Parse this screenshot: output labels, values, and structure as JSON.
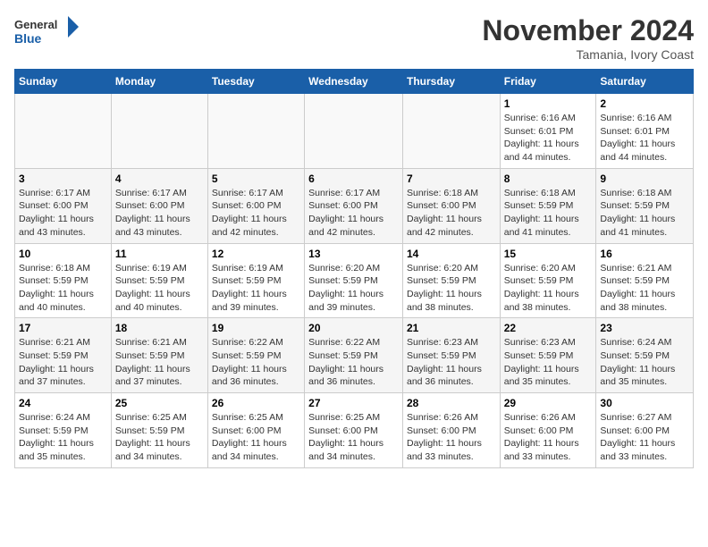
{
  "logo": {
    "general": "General",
    "blue": "Blue"
  },
  "header": {
    "month": "November 2024",
    "location": "Tamania, Ivory Coast"
  },
  "weekdays": [
    "Sunday",
    "Monday",
    "Tuesday",
    "Wednesday",
    "Thursday",
    "Friday",
    "Saturday"
  ],
  "weeks": [
    [
      {
        "day": "",
        "info": ""
      },
      {
        "day": "",
        "info": ""
      },
      {
        "day": "",
        "info": ""
      },
      {
        "day": "",
        "info": ""
      },
      {
        "day": "",
        "info": ""
      },
      {
        "day": "1",
        "info": "Sunrise: 6:16 AM\nSunset: 6:01 PM\nDaylight: 11 hours and 44 minutes."
      },
      {
        "day": "2",
        "info": "Sunrise: 6:16 AM\nSunset: 6:01 PM\nDaylight: 11 hours and 44 minutes."
      }
    ],
    [
      {
        "day": "3",
        "info": "Sunrise: 6:17 AM\nSunset: 6:00 PM\nDaylight: 11 hours and 43 minutes."
      },
      {
        "day": "4",
        "info": "Sunrise: 6:17 AM\nSunset: 6:00 PM\nDaylight: 11 hours and 43 minutes."
      },
      {
        "day": "5",
        "info": "Sunrise: 6:17 AM\nSunset: 6:00 PM\nDaylight: 11 hours and 42 minutes."
      },
      {
        "day": "6",
        "info": "Sunrise: 6:17 AM\nSunset: 6:00 PM\nDaylight: 11 hours and 42 minutes."
      },
      {
        "day": "7",
        "info": "Sunrise: 6:18 AM\nSunset: 6:00 PM\nDaylight: 11 hours and 42 minutes."
      },
      {
        "day": "8",
        "info": "Sunrise: 6:18 AM\nSunset: 5:59 PM\nDaylight: 11 hours and 41 minutes."
      },
      {
        "day": "9",
        "info": "Sunrise: 6:18 AM\nSunset: 5:59 PM\nDaylight: 11 hours and 41 minutes."
      }
    ],
    [
      {
        "day": "10",
        "info": "Sunrise: 6:18 AM\nSunset: 5:59 PM\nDaylight: 11 hours and 40 minutes."
      },
      {
        "day": "11",
        "info": "Sunrise: 6:19 AM\nSunset: 5:59 PM\nDaylight: 11 hours and 40 minutes."
      },
      {
        "day": "12",
        "info": "Sunrise: 6:19 AM\nSunset: 5:59 PM\nDaylight: 11 hours and 39 minutes."
      },
      {
        "day": "13",
        "info": "Sunrise: 6:20 AM\nSunset: 5:59 PM\nDaylight: 11 hours and 39 minutes."
      },
      {
        "day": "14",
        "info": "Sunrise: 6:20 AM\nSunset: 5:59 PM\nDaylight: 11 hours and 38 minutes."
      },
      {
        "day": "15",
        "info": "Sunrise: 6:20 AM\nSunset: 5:59 PM\nDaylight: 11 hours and 38 minutes."
      },
      {
        "day": "16",
        "info": "Sunrise: 6:21 AM\nSunset: 5:59 PM\nDaylight: 11 hours and 38 minutes."
      }
    ],
    [
      {
        "day": "17",
        "info": "Sunrise: 6:21 AM\nSunset: 5:59 PM\nDaylight: 11 hours and 37 minutes."
      },
      {
        "day": "18",
        "info": "Sunrise: 6:21 AM\nSunset: 5:59 PM\nDaylight: 11 hours and 37 minutes."
      },
      {
        "day": "19",
        "info": "Sunrise: 6:22 AM\nSunset: 5:59 PM\nDaylight: 11 hours and 36 minutes."
      },
      {
        "day": "20",
        "info": "Sunrise: 6:22 AM\nSunset: 5:59 PM\nDaylight: 11 hours and 36 minutes."
      },
      {
        "day": "21",
        "info": "Sunrise: 6:23 AM\nSunset: 5:59 PM\nDaylight: 11 hours and 36 minutes."
      },
      {
        "day": "22",
        "info": "Sunrise: 6:23 AM\nSunset: 5:59 PM\nDaylight: 11 hours and 35 minutes."
      },
      {
        "day": "23",
        "info": "Sunrise: 6:24 AM\nSunset: 5:59 PM\nDaylight: 11 hours and 35 minutes."
      }
    ],
    [
      {
        "day": "24",
        "info": "Sunrise: 6:24 AM\nSunset: 5:59 PM\nDaylight: 11 hours and 35 minutes."
      },
      {
        "day": "25",
        "info": "Sunrise: 6:25 AM\nSunset: 5:59 PM\nDaylight: 11 hours and 34 minutes."
      },
      {
        "day": "26",
        "info": "Sunrise: 6:25 AM\nSunset: 6:00 PM\nDaylight: 11 hours and 34 minutes."
      },
      {
        "day": "27",
        "info": "Sunrise: 6:25 AM\nSunset: 6:00 PM\nDaylight: 11 hours and 34 minutes."
      },
      {
        "day": "28",
        "info": "Sunrise: 6:26 AM\nSunset: 6:00 PM\nDaylight: 11 hours and 33 minutes."
      },
      {
        "day": "29",
        "info": "Sunrise: 6:26 AM\nSunset: 6:00 PM\nDaylight: 11 hours and 33 minutes."
      },
      {
        "day": "30",
        "info": "Sunrise: 6:27 AM\nSunset: 6:00 PM\nDaylight: 11 hours and 33 minutes."
      }
    ]
  ]
}
